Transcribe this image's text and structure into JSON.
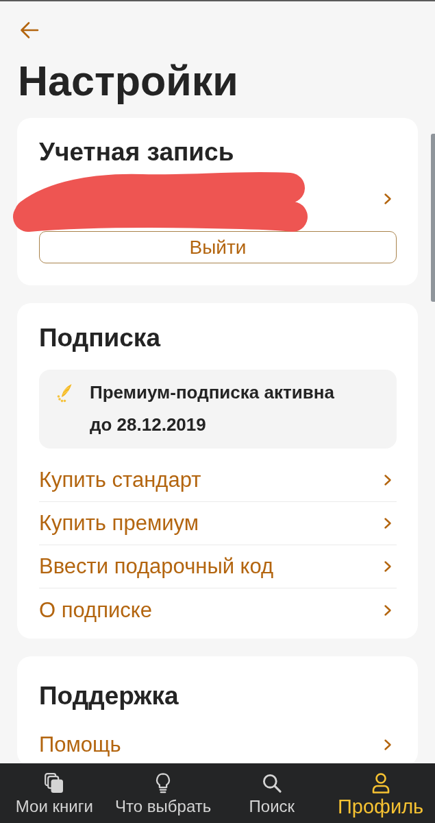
{
  "header": {
    "title": "Настройки"
  },
  "account": {
    "title": "Учетная запись",
    "redacted": true,
    "logout_button": "Выйти"
  },
  "subscription": {
    "title": "Подписка",
    "status": "Премиум-подписка активна до 28.12.2019",
    "links": [
      "Купить стандарт",
      "Купить премиум",
      "Ввести подарочный код",
      "О подписке"
    ]
  },
  "support": {
    "title": "Поддержка",
    "links": [
      "Помощь"
    ]
  },
  "bottom_nav": [
    {
      "label": "Мои книги",
      "selected": false
    },
    {
      "label": "Что выбрать",
      "selected": false
    },
    {
      "label": "Поиск",
      "selected": false
    },
    {
      "label": "Профиль",
      "selected": true
    }
  ]
}
